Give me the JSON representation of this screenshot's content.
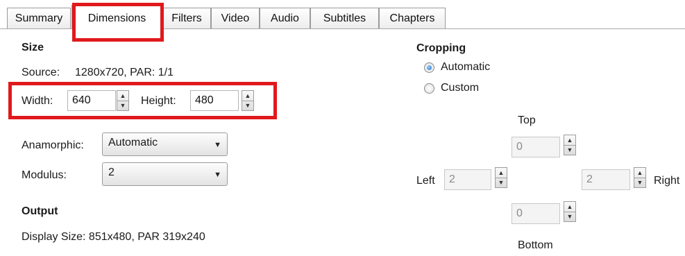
{
  "tabs": [
    "Summary",
    "Dimensions",
    "Filters",
    "Video",
    "Audio",
    "Subtitles",
    "Chapters"
  ],
  "active_tab": "Dimensions",
  "size": {
    "heading": "Size",
    "source_label": "Source:",
    "source_value": "1280x720, PAR: 1/1",
    "width_label": "Width:",
    "width_value": "640",
    "height_label": "Height:",
    "height_value": "480"
  },
  "anamorphic": {
    "label": "Anamorphic:",
    "value": "Automatic"
  },
  "modulus": {
    "label": "Modulus:",
    "value": "2"
  },
  "output": {
    "heading": "Output",
    "display_size": "Display Size: 851x480,  PAR 319x240"
  },
  "cropping": {
    "heading": "Cropping",
    "options": [
      "Automatic",
      "Custom"
    ],
    "selected": "Automatic",
    "top_label": "Top",
    "top_value": "0",
    "left_label": "Left",
    "left_value": "2",
    "right_label": "Right",
    "right_value": "2",
    "bottom_label": "Bottom",
    "bottom_value": "0"
  },
  "colors": {
    "highlight": "#e0191d",
    "radio_selected": "#1d6fc4"
  },
  "icons": {
    "spin_up": "▲",
    "spin_down": "▼",
    "dropdown": "▼"
  }
}
